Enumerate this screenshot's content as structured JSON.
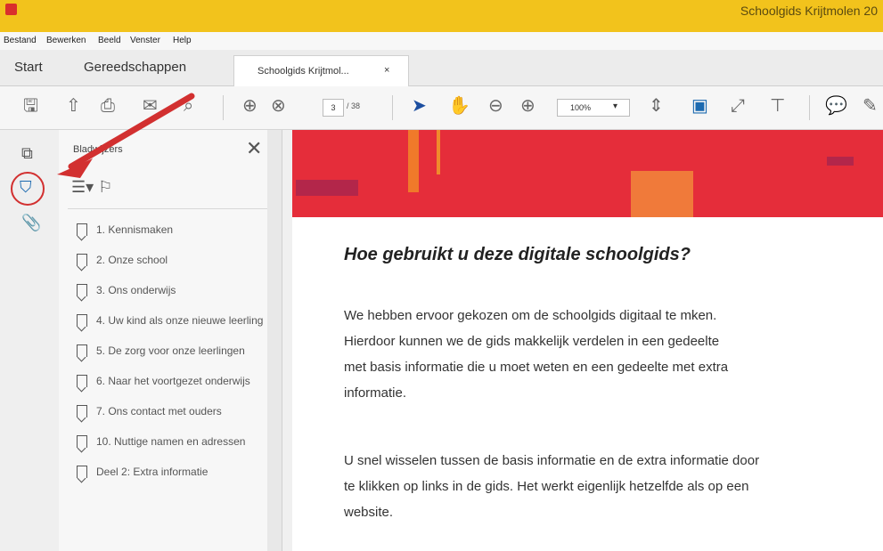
{
  "window": {
    "title": "Schoolgids Krijtmolen 20"
  },
  "menu": [
    "Bestand",
    "Bewerken",
    "Beeld",
    "Venster",
    "Help"
  ],
  "tabs": {
    "start": "Start",
    "tools": "Gereedschappen",
    "doc": "Schoolgids Krijtmol...",
    "close": "×"
  },
  "toolbar": {
    "page": "3",
    "total": "/ 38",
    "zoom": "100%",
    "zoom_caret": "▾"
  },
  "panel": {
    "title": "Bladwijzers",
    "close": "✕"
  },
  "bookmarks": [
    "1. Kennismaken",
    "2. Onze school",
    "3. Ons onderwijs",
    "4. Uw kind als onze nieuwe leerling",
    "5. De zorg voor onze leerlingen",
    "6. Naar het voortgezet onderwijs",
    "7. Ons contact met ouders",
    "10. Nuttige namen en adressen",
    "Deel 2: Extra informatie"
  ],
  "document": {
    "heading": "Hoe gebruikt u deze digitale schoolgids?",
    "para1": [
      "We hebben ervoor gekozen om de schoolgids digitaal te mken.",
      "Hierdoor kunnen we de gids makkelijk verdelen in een gedeelte",
      "met basis informatie die u moet weten en een gedeelte met extra",
      "informatie."
    ],
    "para2": [
      "U snel wisselen tussen de basis informatie en de extra informatie door",
      "te klikken op links in de gids. Het werkt eigenlijk hetzelfde als op een",
      "website."
    ]
  },
  "colors": {
    "titlebar": "#f2c31c",
    "banner": "#e52d3a",
    "annotation": "#d23030"
  }
}
